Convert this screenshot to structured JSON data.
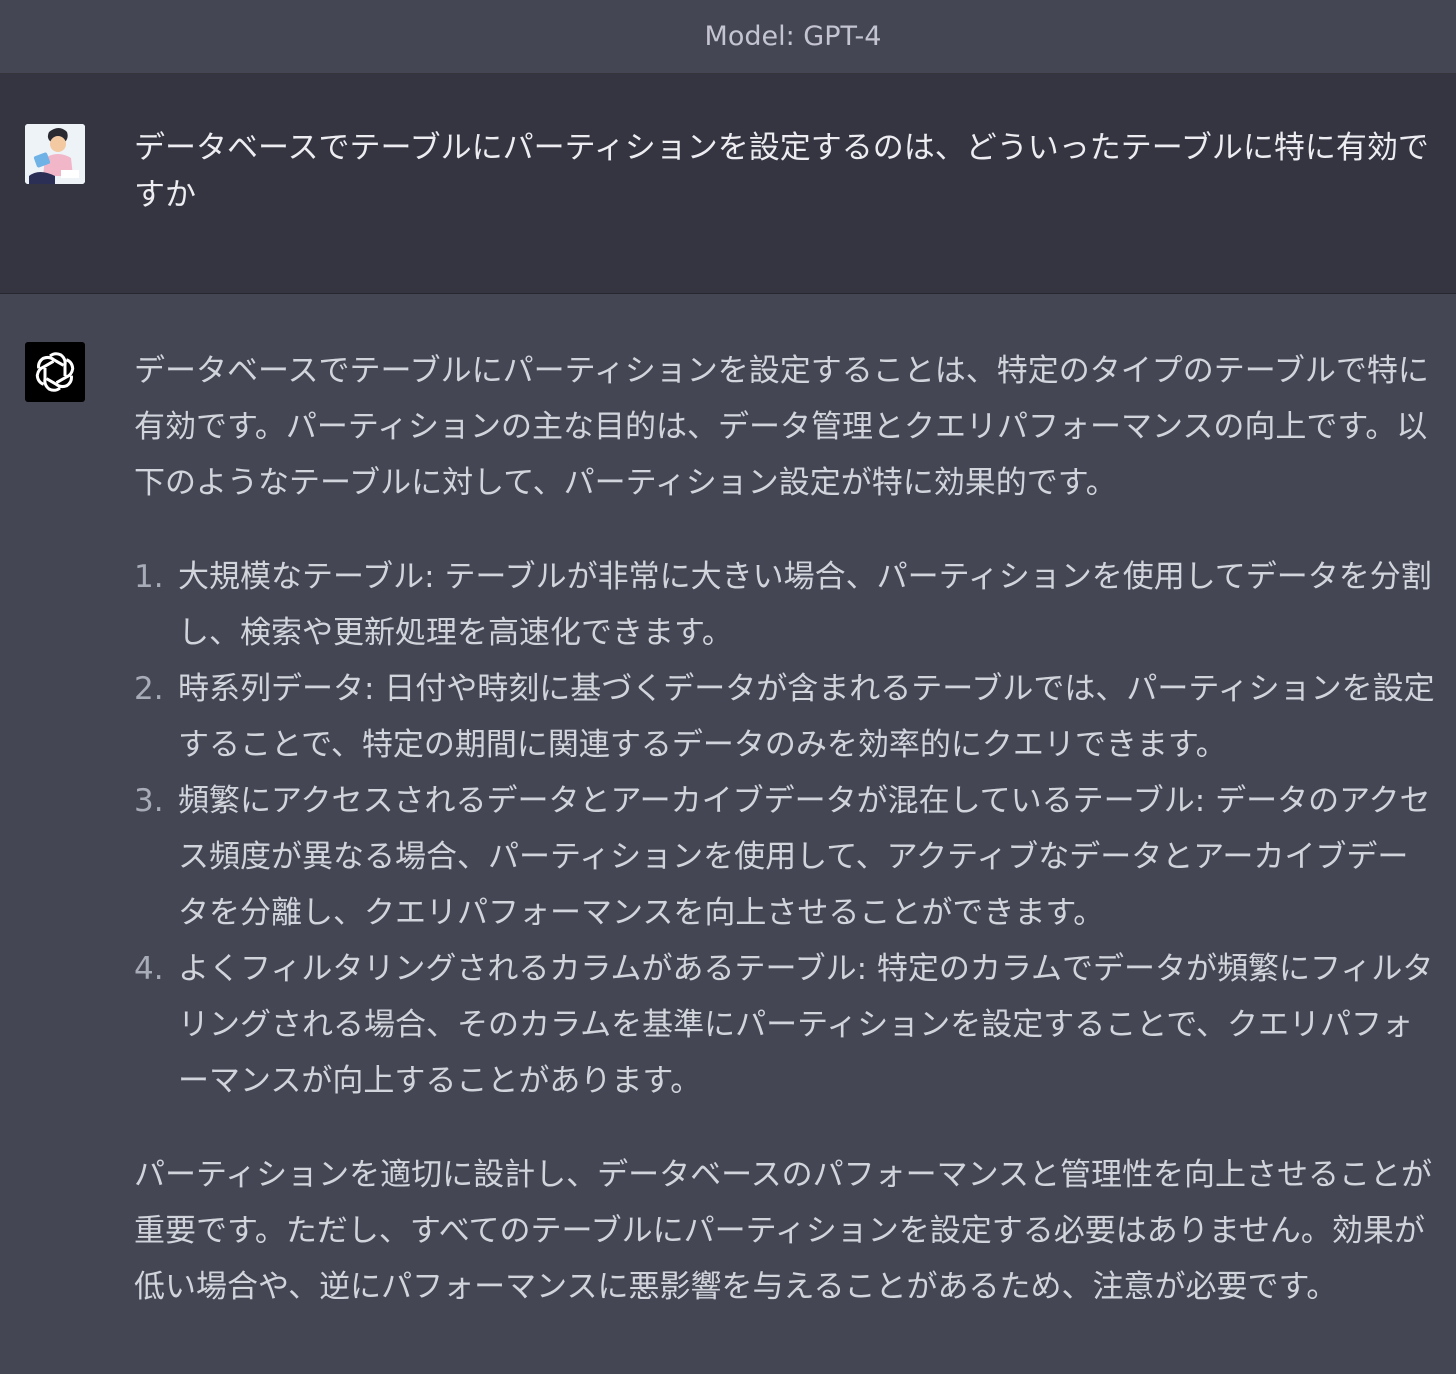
{
  "header": {
    "model_label": "Model: GPT-4"
  },
  "user_message": {
    "avatar_icon": "user-avatar-illustration",
    "text": "データベースでテーブルにパーティションを設定するのは、どういったテーブルに特に有効ですか"
  },
  "assistant_message": {
    "avatar_icon": "openai-logo-icon",
    "intro": "データベースでテーブルにパーティションを設定することは、特定のタイプのテーブルで特に有効です。パーティションの主な目的は、データ管理とクエリパフォーマンスの向上です。以下のようなテーブルに対して、パーティション設定が特に効果的です。",
    "items": [
      {
        "num": "1.",
        "text": "大規模なテーブル: テーブルが非常に大きい場合、パーティションを使用してデータを分割し、検索や更新処理を高速化できます。"
      },
      {
        "num": "2.",
        "text": "時系列データ: 日付や時刻に基づくデータが含まれるテーブルでは、パーティションを設定することで、特定の期間に関連するデータのみを効率的にクエリできます。"
      },
      {
        "num": "3.",
        "text": "頻繁にアクセスされるデータとアーカイブデータが混在しているテーブル: データのアクセス頻度が異なる場合、パーティションを使用して、アクティブなデータとアーカイブデータを分離し、クエリパフォーマンスを向上させることができます。"
      },
      {
        "num": "4.",
        "text": "よくフィルタリングされるカラムがあるテーブル: 特定のカラムでデータが頻繁にフィルタリングされる場合、そのカラムを基準にパーティションを設定することで、クエリパフォーマンスが向上することがあります。"
      }
    ],
    "conclusion": "パーティションを適切に設計し、データベースのパフォーマンスと管理性を向上させることが重要です。ただし、すべてのテーブルにパーティションを設定する必要はありません。効果が低い場合や、逆にパフォーマンスに悪影響を与えることがあるため、注意が必要です。"
  }
}
